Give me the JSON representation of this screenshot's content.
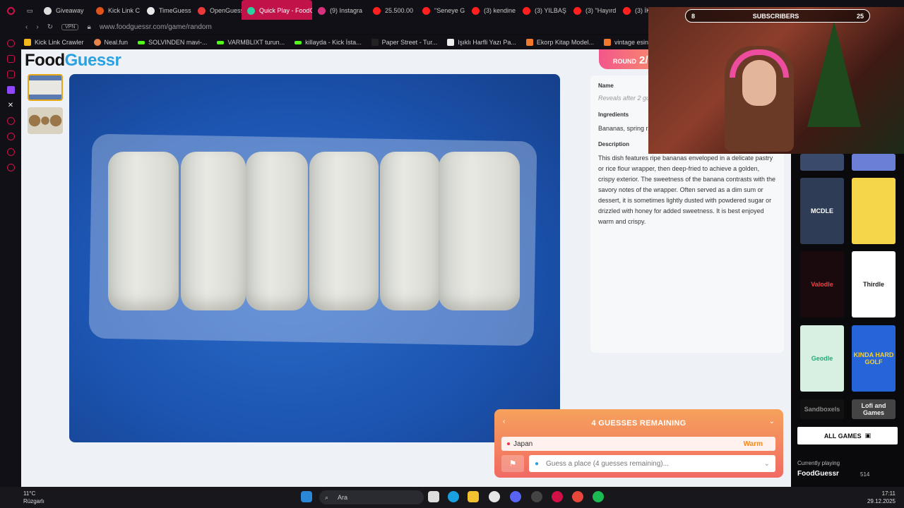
{
  "tabs": [
    {
      "label": "Giveaway",
      "color": "#ddd"
    },
    {
      "label": "Kick Link C",
      "color": "#e0541b"
    },
    {
      "label": "TimeGuess",
      "color": "#e8e8e8"
    },
    {
      "label": "OpenGuess",
      "color": "#e83a3a"
    },
    {
      "label": "Quick Play - FoodGu",
      "color": "#2ecfa0",
      "active": true
    },
    {
      "label": "(9) Instagra",
      "color": "#d6317d"
    },
    {
      "label": "25.500.00",
      "color": "#ff2020"
    },
    {
      "label": "\"Seneye G",
      "color": "#ff2020"
    },
    {
      "label": "(3) kendine",
      "color": "#ff2020"
    },
    {
      "label": "(3) YILBAŞ",
      "color": "#ff2020"
    },
    {
      "label": "(3) \"Hayırd",
      "color": "#ff2020"
    },
    {
      "label": "(3) İKİNCİ",
      "color": "#ff2020"
    }
  ],
  "address": {
    "vpn": "VPN",
    "url": "www.foodguessr.com/game/random"
  },
  "bookmarks": [
    {
      "label": "Kick Link Crawler",
      "color": "#f5b81b"
    },
    {
      "label": "Neal.fun",
      "color": "#e8844a"
    },
    {
      "label": "SOLVINDEN mavi-...",
      "color": "#53fc18"
    },
    {
      "label": "VARMBLIXT turun...",
      "color": "#53fc18"
    },
    {
      "label": "killayda - Kick İsta...",
      "color": "#53fc18"
    },
    {
      "label": "Paper Street - Tur...",
      "color": "#222"
    },
    {
      "label": "Işıklı Harfli Yazı Pa...",
      "color": "#eee"
    },
    {
      "label": "Ekorp Kitap Model...",
      "color": "#f0792a"
    },
    {
      "label": "vintage esintili vini...",
      "color": "#f0792a"
    }
  ],
  "logo": {
    "part1": "Food",
    "part2": "Guessr"
  },
  "round": {
    "label": "ROUND",
    "value": "2/"
  },
  "info": {
    "name_label": "Name",
    "name_value": "Reveals after 2 gu",
    "ingredients_label": "Ingredients",
    "ingredients_text": "Bananas, spring r... seeds (optional), ... coconut flakes (optio...",
    "description_label": "Description",
    "description_text": "This dish features ripe bananas enveloped in a delicate pastry or rice flour wrapper, then deep-fried to achieve a golden, crispy exterior. The sweetness of the banana contrasts with the savory notes of the wrapper. Often served as a dim sum or dessert, it is sometimes lightly dusted with powdered sugar or drizzled with honey for added sweetness. It is best enjoyed warm and crispy."
  },
  "guess": {
    "header": "4 GUESSES REMAINING",
    "previous_guess": "Japan",
    "previous_result": "Warm",
    "input_placeholder": "Guess a place (4 guesses remaining)..."
  },
  "stream": {
    "subscribers_label": "SUBSCRIBERS",
    "sub_left": "8",
    "sub_right": "25"
  },
  "games": {
    "all_games": "ALL GAMES",
    "currently_playing_label": "Currently playing",
    "currently_playing": "FoodGuessr",
    "likes": "514",
    "cards": [
      "MCDLE",
      "Valodle",
      "Thirdle",
      "Geodle",
      "KINDA HARD GOLF",
      "Sandboxels",
      "Lofi and Games"
    ]
  },
  "taskbar": {
    "temp": "11°C",
    "weather": "Rüzgarlı",
    "search": "Ara",
    "time": "17:11",
    "date": "29.12.2025"
  }
}
